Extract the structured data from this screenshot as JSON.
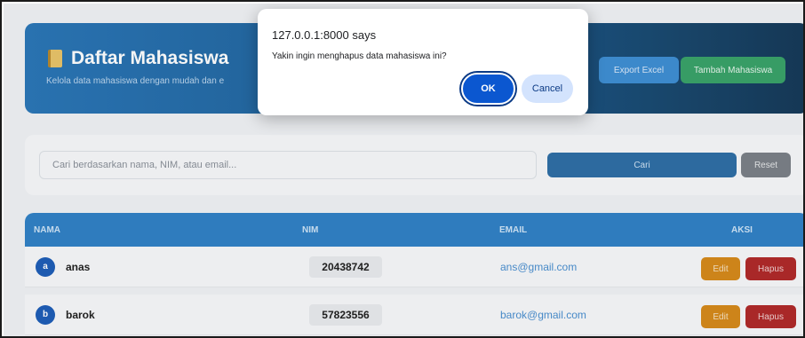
{
  "header": {
    "title": "Daftar Mahasiswa",
    "subtitle": "Kelola data mahasiswa dengan mudah dan e",
    "export_label": "Export Excel",
    "add_label": "Tambah Mahasiswa"
  },
  "search": {
    "placeholder": "Cari berdasarkan nama, NIM, atau email...",
    "search_label": "Cari",
    "reset_label": "Reset"
  },
  "table": {
    "headers": [
      "NAMA",
      "NIM",
      "EMAIL",
      "AKSI"
    ],
    "rows": [
      {
        "initial": "a",
        "name": "anas",
        "nim": "20438742",
        "email": "ans@gmail.com",
        "edit": "Edit",
        "delete": "Hapus"
      },
      {
        "initial": "b",
        "name": "barok",
        "nim": "57823556",
        "email": "barok@gmail.com",
        "edit": "Edit",
        "delete": "Hapus"
      }
    ]
  },
  "dialog": {
    "origin": "127.0.0.1:8000 says",
    "message": "Yakin ingin menghapus data mahasiswa ini?",
    "ok_label": "OK",
    "cancel_label": "Cancel"
  },
  "icons": {
    "header_icon": "book-icon"
  },
  "colors": {
    "primary": "#2b77b8",
    "success": "#3aa36a",
    "warning": "#d68a1c",
    "danger": "#b02a2a",
    "dialog_primary": "#0b57d0"
  }
}
